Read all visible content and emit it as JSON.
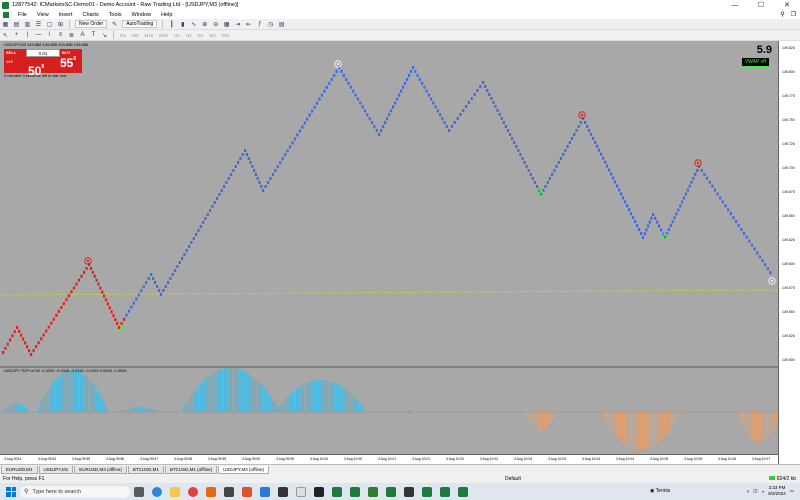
{
  "window": {
    "title": "12877542: ICMarketsSC-Demo01 - Demo Account - Raw Trading Ltd - [USDJPY,M3 (offline)]",
    "controls": [
      "—",
      "☐",
      "✕"
    ]
  },
  "menu": {
    "items": [
      "File",
      "View",
      "Insert",
      "Charts",
      "Tools",
      "Window",
      "Help"
    ]
  },
  "toolbar": {
    "new_order": "New Order",
    "autotrading": "AutoTrading",
    "timeframes": [
      "M1",
      "M5",
      "M15",
      "M30",
      "H1",
      "H4",
      "D1",
      "W1",
      "MN"
    ]
  },
  "chart": {
    "header": "USDJPY,M3  149.885 149.885 149.885 149.885",
    "trade_panel": {
      "sell_label": "SELL",
      "buy_label": "BUY",
      "lot": "0.01",
      "sell_price_prefix": "149",
      "sell_price_big": "50",
      "sell_price_sup": "8",
      "buy_price_prefix": "149",
      "buy_price_big": "55",
      "buy_price_sup": "8"
    },
    "timer_text": "0 minutes 3 seconds left to bar end",
    "big_number": "5.9",
    "vwap_badge": "VWAP off",
    "subpanel_label": "USDJPY  TDPI  of 55 -0.0292 -0.0308 -0.0292 -0.0292 0.0000 -0.0006",
    "y_ticks": [
      "149.825",
      "149.800",
      "149.775",
      "149.750",
      "149.725",
      "149.700",
      "149.675",
      "149.650",
      "149.625",
      "149.600",
      "149.575",
      "149.550",
      "149.525",
      "149.500"
    ],
    "x_ticks": [
      "3 Aug 2024",
      "3 Aug 09:54",
      "3 Aug 09:55",
      "3 Aug 09:56",
      "3 Aug 09:57",
      "3 Aug 09:58",
      "3 Aug 09:59",
      "3 Aug 09:59",
      "3 Aug 09:59",
      "3 Aug 10:00",
      "3 Aug 10:00",
      "3 Aug 10:01",
      "3 Aug 10:01",
      "3 Aug 10:02",
      "3 Aug 10:02",
      "3 Aug 10:03",
      "3 Aug 10:03",
      "3 Aug 10:04",
      "3 Aug 10:04",
      "3 Aug 10:05",
      "3 Aug 10:05",
      "3 Aug 10:06",
      "3 Aug 10:07"
    ],
    "colors": {
      "background": "#a8a8a8",
      "up": "#4169e1",
      "down": "#e02020",
      "hist_up": "#48b8e0",
      "hist_down": "#e0a070",
      "vwap": "#c8d24a"
    }
  },
  "tabs": [
    "EURUSD,M1",
    "USDJPY,M1",
    "EURUSD,M3 (offline)",
    "BTCUSD,M1",
    "BTCUSD,M1 (offline)",
    "USDJPY,M3 (offline)"
  ],
  "active_tab": 5,
  "status": {
    "help": "For Help, press F1",
    "profile": "Default",
    "connection": "824/2 kb"
  },
  "taskbar": {
    "search_placeholder": "Type here to search",
    "weather": "Tennis",
    "time": "3:33 PM",
    "date": "8/3/2024"
  }
}
